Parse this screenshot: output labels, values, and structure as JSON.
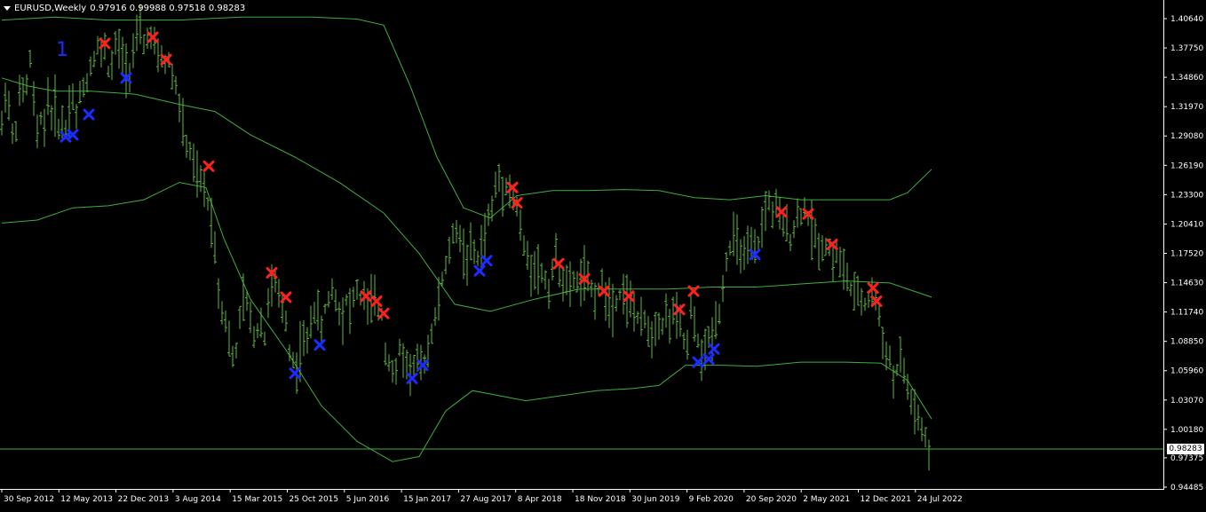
{
  "window": {
    "symbol": "EURUSD,Weekly",
    "ohlc": "0.97916 0.99988 0.97518 0.98283"
  },
  "wave_label": "1",
  "current_price": "0.98283",
  "colors": {
    "background": "#000000",
    "candles": "#5fb83a",
    "bands": "#3fae3f",
    "sell_marker": "#ff2020",
    "buy_marker": "#1a2cff",
    "axis": "#ffffff"
  },
  "chart_data": {
    "type": "line",
    "y_ticks": [
      "1.40640",
      "1.37750",
      "1.34860",
      "1.31970",
      "1.29080",
      "1.26190",
      "1.23300",
      "1.20410",
      "1.17520",
      "1.14630",
      "1.11740",
      "1.08850",
      "1.05960",
      "1.03070",
      "1.00180",
      "0.97375",
      "0.94485"
    ],
    "y_range": [
      0.94485,
      1.4064
    ],
    "x_ticks": [
      "30 Sep 2012",
      "12 May 2013",
      "22 Dec 2013",
      "3 Aug 2014",
      "15 Mar 2015",
      "25 Oct 2015",
      "5 Jun 2016",
      "15 Jan 2017",
      "27 Aug 2017",
      "8 Apr 2018",
      "18 Nov 2018",
      "30 Jun 2019",
      "9 Feb 2020",
      "20 Sep 2020",
      "2 May 2021",
      "12 Dec 2021",
      "24 Jul 2022"
    ],
    "price_series": [
      [
        0,
        1.3
      ],
      [
        4,
        1.335
      ],
      [
        8,
        1.32
      ],
      [
        12,
        1.29
      ],
      [
        16,
        1.3
      ],
      [
        20,
        1.33
      ],
      [
        24,
        1.335
      ],
      [
        28,
        1.34
      ],
      [
        32,
        1.365
      ],
      [
        36,
        1.325
      ],
      [
        40,
        1.29
      ],
      [
        44,
        1.31
      ],
      [
        48,
        1.3
      ],
      [
        52,
        1.33
      ],
      [
        56,
        1.31
      ],
      [
        60,
        1.32
      ],
      [
        64,
        1.3
      ],
      [
        68,
        1.305
      ],
      [
        72,
        1.3
      ],
      [
        76,
        1.32
      ],
      [
        80,
        1.33
      ],
      [
        84,
        1.31
      ],
      [
        88,
        1.33
      ],
      [
        92,
        1.34
      ],
      [
        96,
        1.345
      ],
      [
        100,
        1.36
      ],
      [
        104,
        1.37
      ],
      [
        108,
        1.38
      ],
      [
        112,
        1.37
      ],
      [
        116,
        1.38
      ],
      [
        120,
        1.355
      ],
      [
        124,
        1.36
      ],
      [
        128,
        1.38
      ],
      [
        132,
        1.375
      ],
      [
        136,
        1.37
      ],
      [
        140,
        1.36
      ],
      [
        144,
        1.355
      ],
      [
        148,
        1.375
      ],
      [
        152,
        1.385
      ],
      [
        156,
        1.395
      ],
      [
        160,
        1.38
      ],
      [
        164,
        1.39
      ],
      [
        168,
        1.385
      ],
      [
        172,
        1.38
      ],
      [
        176,
        1.365
      ],
      [
        180,
        1.37
      ],
      [
        184,
        1.36
      ],
      [
        188,
        1.365
      ],
      [
        192,
        1.35
      ],
      [
        196,
        1.34
      ],
      [
        200,
        1.32
      ],
      [
        204,
        1.3
      ],
      [
        208,
        1.28
      ],
      [
        212,
        1.275
      ],
      [
        216,
        1.26
      ],
      [
        220,
        1.25
      ],
      [
        224,
        1.245
      ],
      [
        228,
        1.24
      ],
      [
        232,
        1.225
      ],
      [
        236,
        1.21
      ],
      [
        240,
        1.18
      ],
      [
        244,
        1.14
      ],
      [
        248,
        1.12
      ],
      [
        252,
        1.11
      ],
      [
        256,
        1.09
      ],
      [
        260,
        1.07
      ],
      [
        264,
        1.08
      ],
      [
        268,
        1.11
      ],
      [
        272,
        1.13
      ],
      [
        276,
        1.125
      ],
      [
        280,
        1.11
      ],
      [
        284,
        1.095
      ],
      [
        288,
        1.1
      ],
      [
        292,
        1.11
      ],
      [
        296,
        1.09
      ],
      [
        300,
        1.13
      ],
      [
        304,
        1.14
      ],
      [
        308,
        1.145
      ],
      [
        312,
        1.13
      ],
      [
        316,
        1.12
      ],
      [
        320,
        1.11
      ],
      [
        324,
        1.08
      ],
      [
        328,
        1.07
      ],
      [
        332,
        1.06
      ],
      [
        336,
        1.08
      ],
      [
        340,
        1.09
      ],
      [
        344,
        1.085
      ],
      [
        348,
        1.11
      ],
      [
        352,
        1.12
      ],
      [
        356,
        1.115
      ],
      [
        360,
        1.1
      ],
      [
        364,
        1.12
      ],
      [
        368,
        1.13
      ],
      [
        372,
        1.14
      ],
      [
        376,
        1.13
      ],
      [
        380,
        1.12
      ],
      [
        384,
        1.115
      ],
      [
        388,
        1.13
      ],
      [
        392,
        1.12
      ],
      [
        396,
        1.13
      ],
      [
        400,
        1.14
      ],
      [
        404,
        1.13
      ],
      [
        408,
        1.135
      ],
      [
        412,
        1.12
      ],
      [
        416,
        1.13
      ],
      [
        420,
        1.125
      ],
      [
        424,
        1.12
      ],
      [
        428,
        1.115
      ],
      [
        432,
        1.08
      ],
      [
        436,
        1.07
      ],
      [
        440,
        1.06
      ],
      [
        444,
        1.055
      ],
      [
        448,
        1.08
      ],
      [
        452,
        1.075
      ],
      [
        456,
        1.065
      ],
      [
        460,
        1.06
      ],
      [
        464,
        1.065
      ],
      [
        468,
        1.07
      ],
      [
        472,
        1.06
      ],
      [
        476,
        1.07
      ],
      [
        480,
        1.08
      ],
      [
        484,
        1.1
      ],
      [
        488,
        1.11
      ],
      [
        492,
        1.13
      ],
      [
        496,
        1.15
      ],
      [
        500,
        1.16
      ],
      [
        504,
        1.18
      ],
      [
        508,
        1.19
      ],
      [
        512,
        1.2
      ],
      [
        516,
        1.19
      ],
      [
        520,
        1.175
      ],
      [
        524,
        1.17
      ],
      [
        528,
        1.18
      ],
      [
        532,
        1.175
      ],
      [
        536,
        1.17
      ],
      [
        540,
        1.18
      ],
      [
        544,
        1.195
      ],
      [
        548,
        1.21
      ],
      [
        552,
        1.22
      ],
      [
        556,
        1.24
      ],
      [
        560,
        1.25
      ],
      [
        564,
        1.24
      ],
      [
        568,
        1.245
      ],
      [
        572,
        1.235
      ],
      [
        576,
        1.23
      ],
      [
        580,
        1.22
      ],
      [
        584,
        1.2
      ],
      [
        588,
        1.18
      ],
      [
        592,
        1.17
      ],
      [
        596,
        1.16
      ],
      [
        600,
        1.165
      ],
      [
        604,
        1.16
      ],
      [
        608,
        1.155
      ],
      [
        612,
        1.15
      ],
      [
        616,
        1.14
      ],
      [
        620,
        1.16
      ],
      [
        624,
        1.17
      ],
      [
        628,
        1.16
      ],
      [
        632,
        1.15
      ],
      [
        636,
        1.145
      ],
      [
        640,
        1.14
      ],
      [
        644,
        1.15
      ],
      [
        648,
        1.145
      ],
      [
        652,
        1.15
      ],
      [
        656,
        1.155
      ],
      [
        660,
        1.145
      ],
      [
        664,
        1.14
      ],
      [
        668,
        1.135
      ],
      [
        672,
        1.14
      ],
      [
        676,
        1.145
      ],
      [
        680,
        1.135
      ],
      [
        684,
        1.13
      ],
      [
        688,
        1.125
      ],
      [
        692,
        1.13
      ],
      [
        696,
        1.135
      ],
      [
        700,
        1.14
      ],
      [
        704,
        1.13
      ],
      [
        708,
        1.125
      ],
      [
        712,
        1.12
      ],
      [
        716,
        1.11
      ],
      [
        720,
        1.105
      ],
      [
        724,
        1.11
      ],
      [
        728,
        1.1
      ],
      [
        732,
        1.095
      ],
      [
        736,
        1.105
      ],
      [
        740,
        1.11
      ],
      [
        744,
        1.105
      ],
      [
        748,
        1.115
      ],
      [
        752,
        1.11
      ],
      [
        756,
        1.115
      ],
      [
        760,
        1.11
      ],
      [
        764,
        1.105
      ],
      [
        768,
        1.09
      ],
      [
        772,
        1.08
      ],
      [
        776,
        1.12
      ],
      [
        780,
        1.1
      ],
      [
        784,
        1.09
      ],
      [
        788,
        1.07
      ],
      [
        792,
        1.08
      ],
      [
        796,
        1.09
      ],
      [
        800,
        1.095
      ],
      [
        804,
        1.11
      ],
      [
        808,
        1.12
      ],
      [
        812,
        1.14
      ],
      [
        816,
        1.17
      ],
      [
        820,
        1.18
      ],
      [
        824,
        1.19
      ],
      [
        828,
        1.185
      ],
      [
        832,
        1.18
      ],
      [
        836,
        1.17
      ],
      [
        840,
        1.175
      ],
      [
        844,
        1.18
      ],
      [
        848,
        1.175
      ],
      [
        852,
        1.185
      ],
      [
        856,
        1.2
      ],
      [
        860,
        1.22
      ],
      [
        864,
        1.225
      ],
      [
        868,
        1.215
      ],
      [
        872,
        1.22
      ],
      [
        876,
        1.21
      ],
      [
        880,
        1.2
      ],
      [
        884,
        1.205
      ],
      [
        888,
        1.19
      ],
      [
        892,
        1.2
      ],
      [
        896,
        1.21
      ],
      [
        900,
        1.215
      ],
      [
        904,
        1.22
      ],
      [
        908,
        1.21
      ],
      [
        912,
        1.2
      ],
      [
        916,
        1.19
      ],
      [
        920,
        1.185
      ],
      [
        924,
        1.18
      ],
      [
        928,
        1.185
      ],
      [
        932,
        1.18
      ],
      [
        936,
        1.17
      ],
      [
        940,
        1.175
      ],
      [
        944,
        1.165
      ],
      [
        948,
        1.16
      ],
      [
        952,
        1.15
      ],
      [
        956,
        1.14
      ],
      [
        960,
        1.13
      ],
      [
        964,
        1.135
      ],
      [
        968,
        1.13
      ],
      [
        972,
        1.125
      ],
      [
        976,
        1.13
      ],
      [
        980,
        1.135
      ],
      [
        984,
        1.13
      ],
      [
        988,
        1.11
      ],
      [
        992,
        1.09
      ],
      [
        996,
        1.08
      ],
      [
        1000,
        1.07
      ],
      [
        1004,
        1.05
      ],
      [
        1008,
        1.06
      ],
      [
        1012,
        1.07
      ],
      [
        1016,
        1.06
      ],
      [
        1020,
        1.04
      ],
      [
        1024,
        1.03
      ],
      [
        1028,
        1.02
      ],
      [
        1032,
        1.01
      ],
      [
        1036,
        1.0
      ],
      [
        1040,
        0.99
      ],
      [
        1044,
        0.97
      ],
      [
        1046,
        0.983
      ]
    ],
    "upper_band": [
      [
        0,
        1.405
      ],
      [
        60,
        1.408
      ],
      [
        120,
        1.405
      ],
      [
        200,
        1.405
      ],
      [
        270,
        1.408
      ],
      [
        350,
        1.408
      ],
      [
        400,
        1.406
      ],
      [
        430,
        1.4
      ],
      [
        460,
        1.34
      ],
      [
        490,
        1.27
      ],
      [
        520,
        1.22
      ],
      [
        550,
        1.21
      ],
      [
        580,
        1.232
      ],
      [
        620,
        1.237
      ],
      [
        660,
        1.237
      ],
      [
        700,
        1.238
      ],
      [
        740,
        1.237
      ],
      [
        780,
        1.23
      ],
      [
        820,
        1.228
      ],
      [
        860,
        1.232
      ],
      [
        900,
        1.228
      ],
      [
        950,
        1.228
      ],
      [
        1000,
        1.228
      ],
      [
        1020,
        1.235
      ],
      [
        1047,
        1.258
      ]
    ],
    "middle_band": [
      [
        0,
        1.348
      ],
      [
        30,
        1.34
      ],
      [
        60,
        1.335
      ],
      [
        100,
        1.335
      ],
      [
        150,
        1.332
      ],
      [
        200,
        1.322
      ],
      [
        240,
        1.315
      ],
      [
        280,
        1.292
      ],
      [
        330,
        1.27
      ],
      [
        380,
        1.245
      ],
      [
        430,
        1.215
      ],
      [
        470,
        1.175
      ],
      [
        510,
        1.125
      ],
      [
        550,
        1.118
      ],
      [
        600,
        1.13
      ],
      [
        650,
        1.14
      ],
      [
        700,
        1.14
      ],
      [
        750,
        1.14
      ],
      [
        800,
        1.142
      ],
      [
        850,
        1.142
      ],
      [
        900,
        1.145
      ],
      [
        950,
        1.148
      ],
      [
        1000,
        1.146
      ],
      [
        1047,
        1.132
      ]
    ],
    "lower_band": [
      [
        0,
        1.205
      ],
      [
        40,
        1.208
      ],
      [
        80,
        1.22
      ],
      [
        120,
        1.222
      ],
      [
        160,
        1.228
      ],
      [
        200,
        1.245
      ],
      [
        230,
        1.24
      ],
      [
        250,
        1.19
      ],
      [
        280,
        1.13
      ],
      [
        320,
        1.08
      ],
      [
        360,
        1.025
      ],
      [
        400,
        0.99
      ],
      [
        440,
        0.97
      ],
      [
        470,
        0.975
      ],
      [
        500,
        1.02
      ],
      [
        530,
        1.04
      ],
      [
        560,
        1.035
      ],
      [
        590,
        1.03
      ],
      [
        630,
        1.035
      ],
      [
        670,
        1.04
      ],
      [
        710,
        1.042
      ],
      [
        740,
        1.045
      ],
      [
        770,
        1.065
      ],
      [
        810,
        1.065
      ],
      [
        850,
        1.064
      ],
      [
        900,
        1.068
      ],
      [
        950,
        1.068
      ],
      [
        990,
        1.067
      ],
      [
        1020,
        1.05
      ],
      [
        1047,
        1.012
      ]
    ],
    "sell_markers": [
      [
        116,
        1.382
      ],
      [
        170,
        1.388
      ],
      [
        185,
        1.366
      ],
      [
        233,
        1.261
      ],
      [
        304,
        1.156
      ],
      [
        320,
        1.132
      ],
      [
        410,
        1.133
      ],
      [
        422,
        1.128
      ],
      [
        430,
        1.116
      ],
      [
        575,
        1.24
      ],
      [
        580,
        1.225
      ],
      [
        627,
        1.165
      ],
      [
        656,
        1.15
      ],
      [
        678,
        1.138
      ],
      [
        706,
        1.133
      ],
      [
        763,
        1.12
      ],
      [
        779,
        1.138
      ],
      [
        878,
        1.216
      ],
      [
        908,
        1.214
      ],
      [
        935,
        1.184
      ],
      [
        981,
        1.141
      ],
      [
        985,
        1.128
      ]
    ],
    "buy_markers": [
      [
        72,
        1.29
      ],
      [
        80,
        1.292
      ],
      [
        98,
        1.312
      ],
      [
        140,
        1.348
      ],
      [
        330,
        1.057
      ],
      [
        358,
        1.085
      ],
      [
        462,
        1.052
      ],
      [
        474,
        1.065
      ],
      [
        538,
        1.158
      ],
      [
        546,
        1.168
      ],
      [
        784,
        1.068
      ],
      [
        796,
        1.071
      ],
      [
        802,
        1.081
      ],
      [
        848,
        1.174
      ]
    ]
  }
}
